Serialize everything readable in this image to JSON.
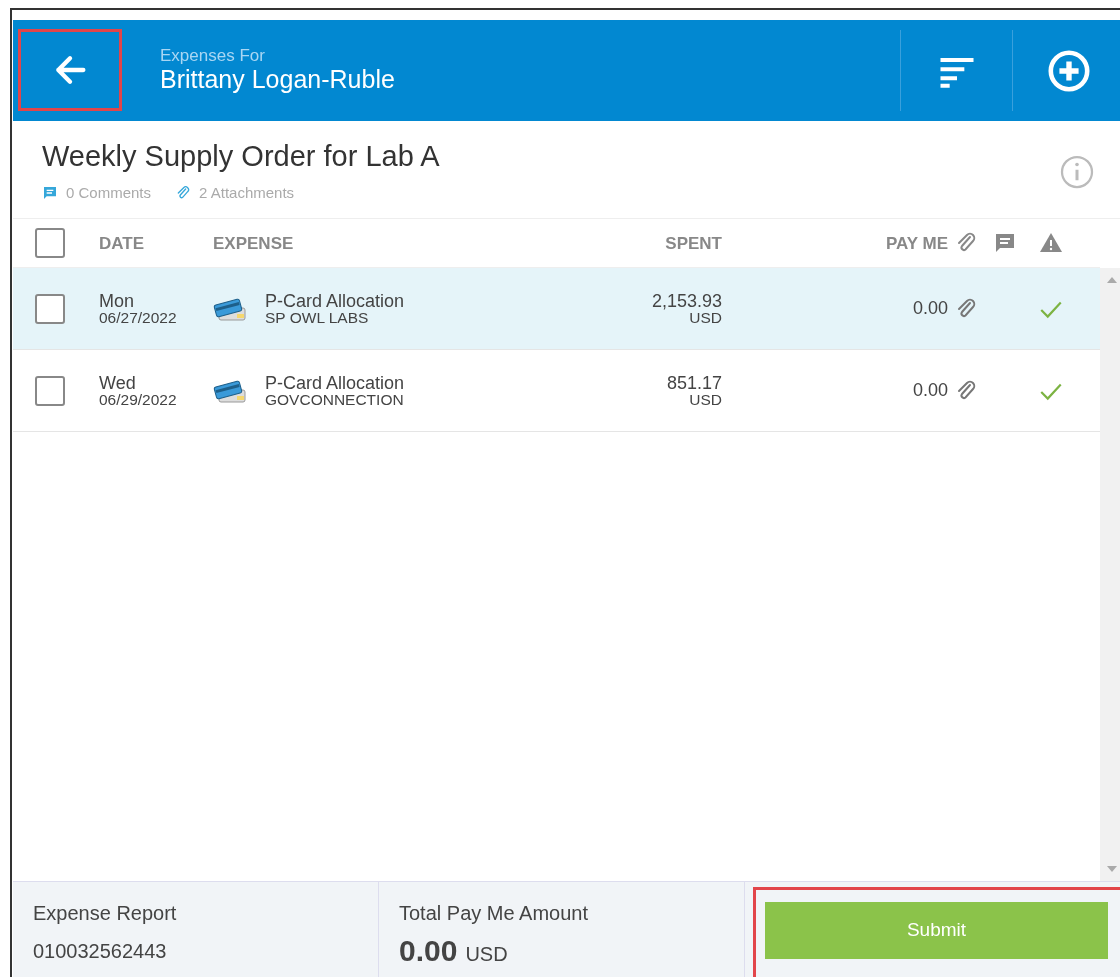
{
  "header": {
    "back_highlighted": true,
    "subtitle": "Expenses For",
    "title": "Brittany Logan-Ruble"
  },
  "report": {
    "title": "Weekly Supply Order for Lab A",
    "comments": "0 Comments",
    "attachments": "2 Attachments"
  },
  "table": {
    "select_all_checked": false,
    "columns": [
      "DATE",
      "EXPENSE",
      "SPENT",
      "PAY ME"
    ],
    "rows": [
      {
        "selected": true,
        "checked": false,
        "day": "Mon",
        "date": "06/27/2022",
        "expense": "P-Card Allocation",
        "vendor": "SP OWL LABS",
        "spent": "2,153.93",
        "currency": "USD",
        "pay_me": "0.00",
        "has_attachment": true,
        "ok": true
      },
      {
        "selected": false,
        "checked": false,
        "day": "Wed",
        "date": "06/29/2022",
        "expense": "P-Card Allocation",
        "vendor": "GOVCONNECTION",
        "spent": "851.17",
        "currency": "USD",
        "pay_me": "0.00",
        "has_attachment": true,
        "ok": true
      }
    ]
  },
  "footer": {
    "report_label": "Expense Report",
    "report_number": "010032562443",
    "total_label": "Total Pay Me Amount",
    "total": "0.00",
    "total_currency": "USD",
    "submit": "Submit",
    "submit_highlighted": true
  }
}
